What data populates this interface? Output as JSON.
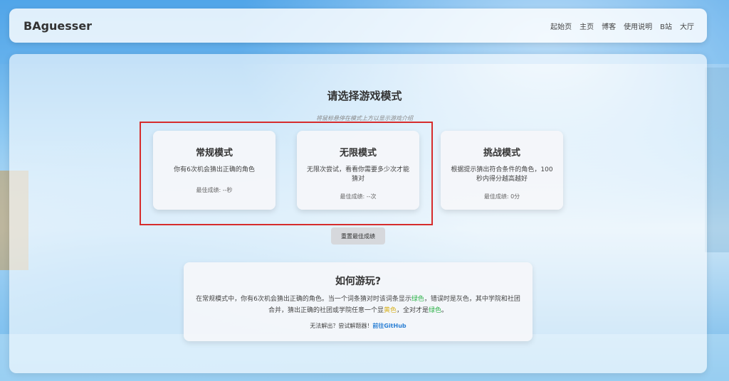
{
  "navbar": {
    "brand": "BAguesser",
    "links": [
      "起始页",
      "主页",
      "博客",
      "使用说明",
      "B站",
      "大厅"
    ]
  },
  "page": {
    "title": "请选择游戏模式",
    "hint": "将鼠标悬停在模式上方以显示游戏介绍"
  },
  "modes": [
    {
      "name": "常规模式",
      "desc": "你有6次机会猜出正确的角色",
      "best": "最佳成绩: --秒"
    },
    {
      "name": "无限模式",
      "desc": "无限次尝试，看看你需要多少次才能猜对",
      "best": "最佳成绩: --次"
    },
    {
      "name": "挑战模式",
      "desc": "根据提示猜出符合条件的角色，100秒内得分越高越好",
      "best": "最佳成绩: 0分"
    }
  ],
  "reset_label": "重置最佳成绩",
  "howto": {
    "title": "如何游玩?",
    "text_1": "在常规模式中，你有6次机会猜出正确的角色。当一个词条猜对时该词条显示",
    "green_1": "绿色",
    "text_2": "，错误时是灰色，其中学院和社团合并，猜出正确的社团或学院任意一个显",
    "yellow": "黄色",
    "text_3": "，全对才是",
    "green_2": "绿色",
    "text_4": "。",
    "foot_text": "无法解出？尝试解题器！",
    "github_link": "前往GitHub"
  },
  "colors": {
    "highlight_box": "#d62c2c",
    "green": "#2fb34a",
    "yellow": "#d9b21f",
    "link": "#2a7fd4"
  }
}
